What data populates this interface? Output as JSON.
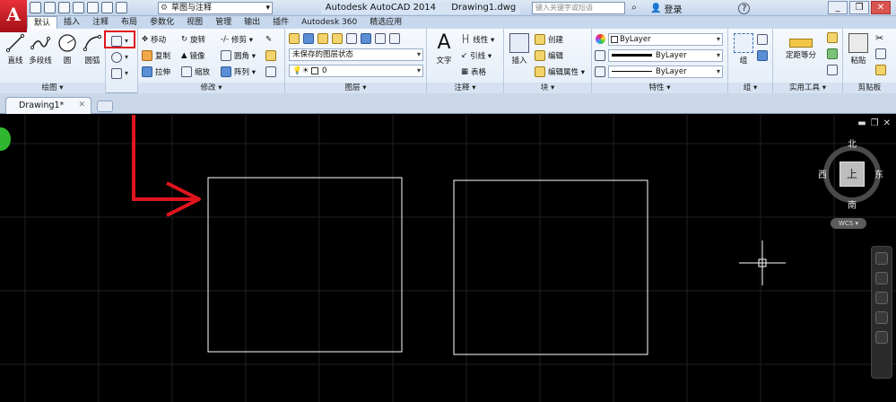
{
  "app": {
    "logo_letter": "A",
    "workspace": "草图与注释",
    "title": "Autodesk AutoCAD 2014",
    "filename": "Drawing1.dwg",
    "search_placeholder": "键入关键字或短语",
    "signin_label": "登录",
    "help_label": "?"
  },
  "tabs": [
    "默认",
    "插入",
    "注释",
    "布局",
    "参数化",
    "视图",
    "管理",
    "输出",
    "插件",
    "Autodesk 360",
    "精选应用"
  ],
  "ribbon": {
    "draw": {
      "title": "绘图 ▾",
      "line": "直线",
      "polyline": "多段线",
      "circle": "圆",
      "arc": "圆弧"
    },
    "modify": {
      "title": "修改 ▾",
      "move": "移动",
      "rotate": "旋转",
      "trim": "修剪 ▾",
      "copy": "复制",
      "mirror": "镜像",
      "fillet": "圆角 ▾",
      "stretch": "拉伸",
      "scale": "缩放",
      "array": "阵列 ▾"
    },
    "layers": {
      "title": "图层 ▾",
      "layer_state": "未保存的图层状态",
      "current_layer": "0"
    },
    "annotation": {
      "title": "注释 ▾",
      "text": "文字",
      "linear": "线性 ▾",
      "leader": "引线 ▾",
      "table": "表格"
    },
    "block": {
      "title": "块 ▾",
      "insert": "插入",
      "create": "创建",
      "edit": "编辑",
      "edit_attributes": "编辑属性 ▾"
    },
    "properties": {
      "title": "特性 ▾",
      "color": "ByLayer",
      "lineweight": "ByLayer",
      "linetype": "ByLayer"
    },
    "groups": {
      "title": "组 ▾",
      "group": "组"
    },
    "utilities": {
      "title": "实用工具 ▾",
      "measure": "定距等分"
    },
    "clipboard": {
      "title": "剪贴板",
      "paste": "粘贴"
    }
  },
  "document": {
    "tab_label": "Drawing1*",
    "close_label": "✕"
  },
  "viewcube": {
    "north": "北",
    "south": "南",
    "east": "东",
    "west": "西",
    "face": "上",
    "wcs": "WCS ▾"
  },
  "colors": {
    "canvas": "#000000",
    "annotation_red": "#e0151d",
    "geometry": "#ffffff",
    "grid": "#1f1f1f"
  }
}
